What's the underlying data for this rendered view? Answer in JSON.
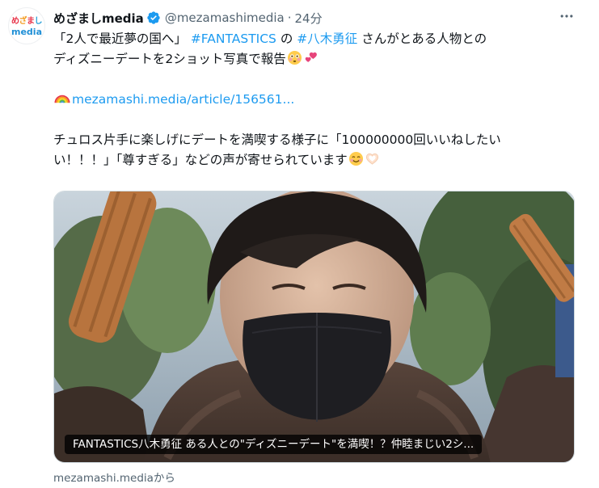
{
  "account": {
    "display_name": "めざましmedia",
    "handle": "@mezamashimedia",
    "separator": "·",
    "timestamp": "24分",
    "avatar_line1": [
      "め",
      "ざ",
      "ま",
      "し"
    ],
    "avatar_line2": "media"
  },
  "tweet": {
    "line1_pre": "「2人で最近夢の国へ」",
    "hashtag1": "#FANTASTICS",
    "line1_mid": "の",
    "hashtag2": "#八木勇征",
    "line1_post": "さんがとある人物との",
    "line2": "ディズニーデートを2ショット写真で報告",
    "link_text": "mezamashi.media/article/156561...",
    "line4": "チュロス片手に楽しげにデートを満喫する様子に「100000000回いいねしたい",
    "line5": "い！！！」「尊すぎる」などの声が寄せられています"
  },
  "card": {
    "caption": "FANTASTICS八木勇征 ある人との\"ディズニーデート\"を満喫！？仲睦まじい2シ..."
  },
  "source": {
    "text": "mezamashi.mediaから"
  },
  "icons": {
    "verified": "verified-badge-icon",
    "more": "more-options-icon",
    "rainbow": "rainbow-emoji",
    "flushed": "flushed-face-emoji",
    "hearts": "two-hearts-emoji",
    "smile": "smiling-face-emoji",
    "heart_hands": "heart-hands-emoji"
  },
  "colors": {
    "link": "#1d9bf0",
    "secondary_text": "#536471",
    "primary_text": "#0f1419"
  }
}
